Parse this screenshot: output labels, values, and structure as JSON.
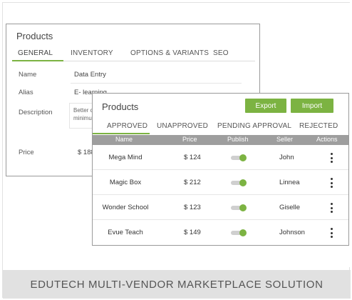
{
  "back_panel": {
    "title": "Products",
    "tabs": [
      "GENERAL",
      "INVENTORY",
      "OPTIONS & VARIANTS",
      "SEO"
    ],
    "fields": {
      "name_label": "Name",
      "name_value": "Data Entry",
      "alias_label": "Alias",
      "alias_value": "E- learning",
      "description_label": "Description",
      "description_value": "Better c minimu",
      "price_label": "Price",
      "price_value": "$ 188"
    }
  },
  "front_panel": {
    "title": "Products",
    "export_label": "Export",
    "import_label": "Import",
    "tabs": [
      "APPROVED",
      "UNAPPROVED",
      "PENDING APPROVAL",
      "REJECTED"
    ],
    "columns": [
      "Name",
      "Price",
      "Publish",
      "Seller",
      "Actions"
    ],
    "rows": [
      {
        "name": "Mega Mind",
        "price": "$ 124",
        "seller": "John"
      },
      {
        "name": "Magic Box",
        "price": "$ 212",
        "seller": "Linnea"
      },
      {
        "name": "Wonder School",
        "price": "$ 123",
        "seller": "Giselle"
      },
      {
        "name": "Evue Teach",
        "price": "$ 149",
        "seller": "Johnson"
      }
    ]
  },
  "footer": {
    "caption": "EDUTECH MULTI-VENDOR MARKETPLACE SOLUTION"
  },
  "colors": {
    "accent": "#7cb342",
    "table_header": "#9e9e9e",
    "footer_bg": "#e1e1e1"
  }
}
